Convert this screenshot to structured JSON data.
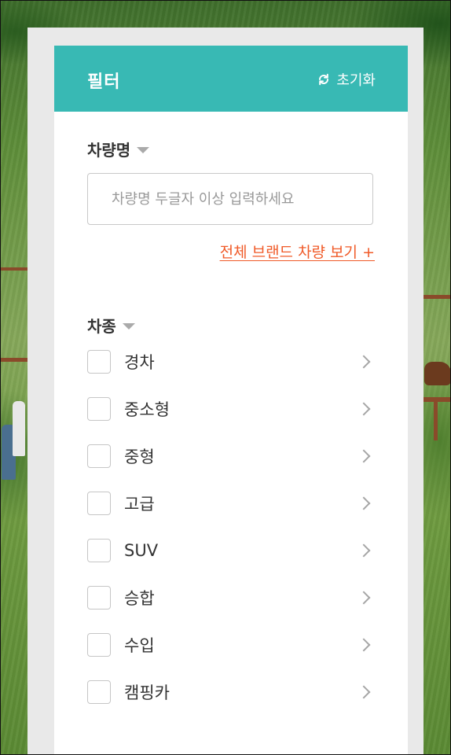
{
  "filter": {
    "title": "필터",
    "reset_label": "초기화",
    "reset_icon": "refresh-icon"
  },
  "car_name": {
    "label": "차량명",
    "placeholder": "차량명 두글자 이상 입력하세요",
    "value": "",
    "all_brands_link": "전체 브랜드 차량 보기 +"
  },
  "car_type": {
    "label": "차종",
    "items": [
      {
        "label": "경차",
        "checked": false
      },
      {
        "label": "중소형",
        "checked": false
      },
      {
        "label": "중형",
        "checked": false
      },
      {
        "label": "고급",
        "checked": false
      },
      {
        "label": "SUV",
        "checked": false
      },
      {
        "label": "승합",
        "checked": false
      },
      {
        "label": "수입",
        "checked": false
      },
      {
        "label": "캠핑카",
        "checked": false
      }
    ]
  },
  "colors": {
    "header_bg": "#38b9b4",
    "link": "#f05a28",
    "text": "#333333"
  }
}
